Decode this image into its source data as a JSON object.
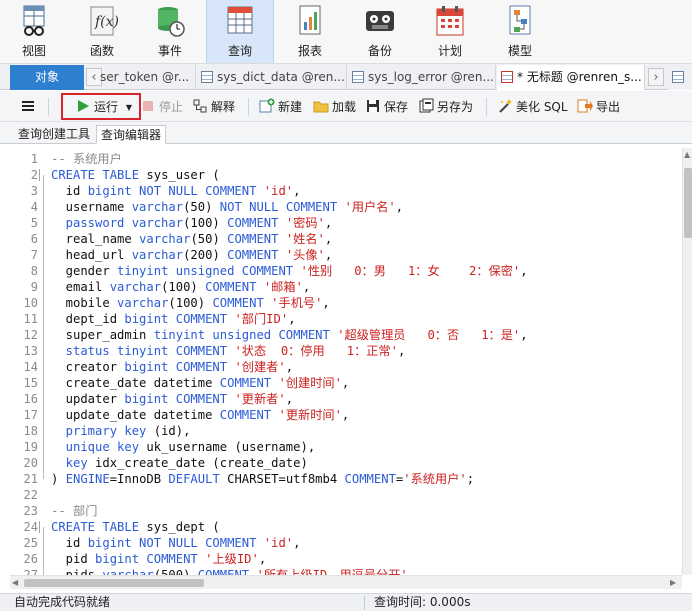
{
  "ribbon": {
    "items": [
      {
        "label": "视图",
        "icon": "view-icon"
      },
      {
        "label": "函数",
        "icon": "function-icon"
      },
      {
        "label": "事件",
        "icon": "event-icon"
      },
      {
        "label": "查询",
        "icon": "query-icon"
      },
      {
        "label": "报表",
        "icon": "report-icon"
      },
      {
        "label": "备份",
        "icon": "backup-icon"
      },
      {
        "label": "计划",
        "icon": "schedule-icon"
      },
      {
        "label": "模型",
        "icon": "model-icon"
      }
    ],
    "active_index": 3
  },
  "tabs": {
    "objects": "对象",
    "items": [
      {
        "label": "ser_token @r..."
      },
      {
        "label": "sys_dict_data @ren..."
      },
      {
        "label": "sys_log_error @ren..."
      },
      {
        "label": "* 无标题 @renren_s..."
      }
    ],
    "nav_prev": "‹",
    "nav_next": "›"
  },
  "toolbar": {
    "menu_icon": "hamburger-icon",
    "run": "运行",
    "stop": "停止",
    "explain": "解释",
    "new": "新建",
    "load": "加载",
    "save": "保存",
    "save_as": "另存为",
    "beautify": "美化 SQL",
    "export": "导出"
  },
  "subtabs": {
    "builder": "查询创建工具",
    "editor": "查询编辑器"
  },
  "editor": {
    "lines": [
      {
        "n": "1",
        "tokens": [
          [
            "cm",
            "-- 系统用户"
          ]
        ]
      },
      {
        "n": "2",
        "fold": true,
        "tokens": [
          [
            "kw",
            "CREATE TABLE"
          ],
          [
            "id",
            " sys_user ("
          ]
        ]
      },
      {
        "n": "3",
        "tokens": [
          [
            "id",
            "  id "
          ],
          [
            "kw",
            "bigint NOT NULL COMMENT"
          ],
          [
            "id",
            " "
          ],
          [
            "str",
            "'id'"
          ],
          [
            "id",
            ","
          ]
        ]
      },
      {
        "n": "4",
        "tokens": [
          [
            "id",
            "  username "
          ],
          [
            "kw",
            "varchar"
          ],
          [
            "id",
            "(50) "
          ],
          [
            "kw",
            "NOT NULL COMMENT"
          ],
          [
            "id",
            " "
          ],
          [
            "str",
            "'用户名'"
          ],
          [
            "id",
            ","
          ]
        ]
      },
      {
        "n": "5",
        "tokens": [
          [
            "kw",
            "  password varchar"
          ],
          [
            "id",
            "(100) "
          ],
          [
            "kw",
            "COMMENT"
          ],
          [
            "id",
            " "
          ],
          [
            "str",
            "'密码'"
          ],
          [
            "id",
            ","
          ]
        ]
      },
      {
        "n": "6",
        "tokens": [
          [
            "id",
            "  real_name "
          ],
          [
            "kw",
            "varchar"
          ],
          [
            "id",
            "(50) "
          ],
          [
            "kw",
            "COMMENT"
          ],
          [
            "id",
            " "
          ],
          [
            "str",
            "'姓名'"
          ],
          [
            "id",
            ","
          ]
        ]
      },
      {
        "n": "7",
        "tokens": [
          [
            "id",
            "  head_url "
          ],
          [
            "kw",
            "varchar"
          ],
          [
            "id",
            "(200) "
          ],
          [
            "kw",
            "COMMENT"
          ],
          [
            "id",
            " "
          ],
          [
            "str",
            "'头像'"
          ],
          [
            "id",
            ","
          ]
        ]
      },
      {
        "n": "8",
        "tokens": [
          [
            "id",
            "  gender "
          ],
          [
            "kw",
            "tinyint unsigned COMMENT"
          ],
          [
            "id",
            " "
          ],
          [
            "str",
            "'性别   0：男   1：女    2：保密'"
          ],
          [
            "id",
            ","
          ]
        ]
      },
      {
        "n": "9",
        "tokens": [
          [
            "id",
            "  email "
          ],
          [
            "kw",
            "varchar"
          ],
          [
            "id",
            "(100) "
          ],
          [
            "kw",
            "COMMENT"
          ],
          [
            "id",
            " "
          ],
          [
            "str",
            "'邮箱'"
          ],
          [
            "id",
            ","
          ]
        ]
      },
      {
        "n": "10",
        "tokens": [
          [
            "id",
            "  mobile "
          ],
          [
            "kw",
            "varchar"
          ],
          [
            "id",
            "(100) "
          ],
          [
            "kw",
            "COMMENT"
          ],
          [
            "id",
            " "
          ],
          [
            "str",
            "'手机号'"
          ],
          [
            "id",
            ","
          ]
        ]
      },
      {
        "n": "11",
        "tokens": [
          [
            "id",
            "  dept_id "
          ],
          [
            "kw",
            "bigint COMMENT"
          ],
          [
            "id",
            " "
          ],
          [
            "str",
            "'部门ID'"
          ],
          [
            "id",
            ","
          ]
        ]
      },
      {
        "n": "12",
        "tokens": [
          [
            "id",
            "  super_admin "
          ],
          [
            "kw",
            "tinyint unsigned COMMENT"
          ],
          [
            "id",
            " "
          ],
          [
            "str",
            "'超级管理员   0：否   1：是'"
          ],
          [
            "id",
            ","
          ]
        ]
      },
      {
        "n": "13",
        "tokens": [
          [
            "kw",
            "  status tinyint COMMENT"
          ],
          [
            "id",
            " "
          ],
          [
            "str",
            "'状态  0：停用   1：正常'"
          ],
          [
            "id",
            ","
          ]
        ]
      },
      {
        "n": "14",
        "tokens": [
          [
            "id",
            "  creator "
          ],
          [
            "kw",
            "bigint COMMENT"
          ],
          [
            "id",
            " "
          ],
          [
            "str",
            "'创建者'"
          ],
          [
            "id",
            ","
          ]
        ]
      },
      {
        "n": "15",
        "tokens": [
          [
            "id",
            "  create_date datetime "
          ],
          [
            "kw",
            "COMMENT"
          ],
          [
            "id",
            " "
          ],
          [
            "str",
            "'创建时间'"
          ],
          [
            "id",
            ","
          ]
        ]
      },
      {
        "n": "16",
        "tokens": [
          [
            "id",
            "  updater "
          ],
          [
            "kw",
            "bigint COMMENT"
          ],
          [
            "id",
            " "
          ],
          [
            "str",
            "'更新者'"
          ],
          [
            "id",
            ","
          ]
        ]
      },
      {
        "n": "17",
        "tokens": [
          [
            "id",
            "  update_date datetime "
          ],
          [
            "kw",
            "COMMENT"
          ],
          [
            "id",
            " "
          ],
          [
            "str",
            "'更新时间'"
          ],
          [
            "id",
            ","
          ]
        ]
      },
      {
        "n": "18",
        "tokens": [
          [
            "kw",
            "  primary key"
          ],
          [
            "id",
            " (id),"
          ]
        ]
      },
      {
        "n": "19",
        "tokens": [
          [
            "kw",
            "  unique key"
          ],
          [
            "id",
            " uk_username (username),"
          ]
        ]
      },
      {
        "n": "20",
        "tokens": [
          [
            "kw",
            "  key"
          ],
          [
            "id",
            " idx_create_date (create_date)"
          ]
        ]
      },
      {
        "n": "21",
        "tokens": [
          [
            "id",
            ") "
          ],
          [
            "kw",
            "ENGINE"
          ],
          [
            "id",
            "=InnoDB "
          ],
          [
            "kw",
            "DEFAULT"
          ],
          [
            "id",
            " CHARSET=utf8mb4 "
          ],
          [
            "kw",
            "COMMENT"
          ],
          [
            "id",
            "="
          ],
          [
            "str",
            "'系统用户'"
          ],
          [
            "id",
            ";"
          ]
        ]
      },
      {
        "n": "22",
        "tokens": []
      },
      {
        "n": "23",
        "tokens": [
          [
            "cm",
            "-- 部门"
          ]
        ]
      },
      {
        "n": "24",
        "fold": true,
        "tokens": [
          [
            "kw",
            "CREATE TABLE"
          ],
          [
            "id",
            " sys_dept ("
          ]
        ]
      },
      {
        "n": "25",
        "tokens": [
          [
            "id",
            "  id "
          ],
          [
            "kw",
            "bigint NOT NULL COMMENT"
          ],
          [
            "id",
            " "
          ],
          [
            "str",
            "'id'"
          ],
          [
            "id",
            ","
          ]
        ]
      },
      {
        "n": "26",
        "tokens": [
          [
            "id",
            "  pid "
          ],
          [
            "kw",
            "bigint COMMENT"
          ],
          [
            "id",
            " "
          ],
          [
            "str",
            "'上级ID'"
          ],
          [
            "id",
            ","
          ]
        ]
      },
      {
        "n": "27",
        "tokens": [
          [
            "id",
            "  pids "
          ],
          [
            "kw",
            "varchar"
          ],
          [
            "id",
            "(500) "
          ],
          [
            "kw",
            "COMMENT"
          ],
          [
            "id",
            " "
          ],
          [
            "str",
            "'所有上级ID，用逗号分开'"
          ],
          [
            "id",
            ","
          ]
        ]
      }
    ]
  },
  "status": {
    "left": "自动完成代码就绪",
    "right": "查询时间: 0.000s"
  },
  "colors": {
    "keyword": "#2b5bd7",
    "string": "#cc2222",
    "comment": "#8a8a8a",
    "accent": "#2f7fd0",
    "run_highlight": "#d9232d"
  }
}
